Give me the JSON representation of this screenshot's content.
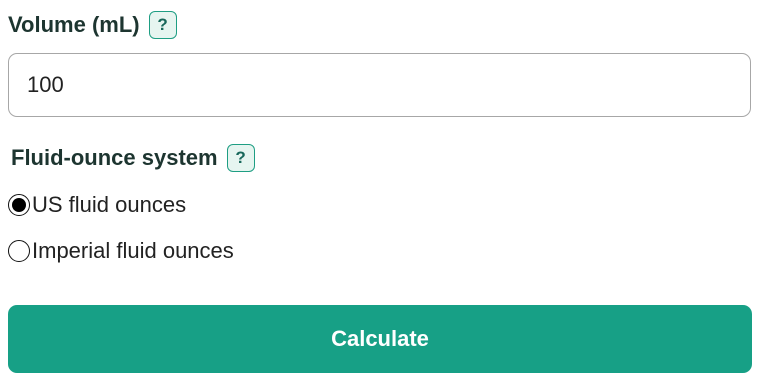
{
  "volume": {
    "label": "Volume (mL)",
    "help": "?",
    "value": "100"
  },
  "system": {
    "label": "Fluid-ounce system",
    "help": "?",
    "options": [
      {
        "label": "US fluid ounces",
        "selected": true
      },
      {
        "label": "Imperial fluid ounces",
        "selected": false
      }
    ]
  },
  "calculate_label": "Calculate",
  "colors": {
    "accent": "#17a086",
    "help_bg": "#e6f5f0",
    "help_border": "#1e9e83"
  },
  "icons": {
    "help": "question-mark-icon",
    "radio_selected": "radio-selected-icon",
    "radio_unselected": "radio-unselected-icon"
  }
}
